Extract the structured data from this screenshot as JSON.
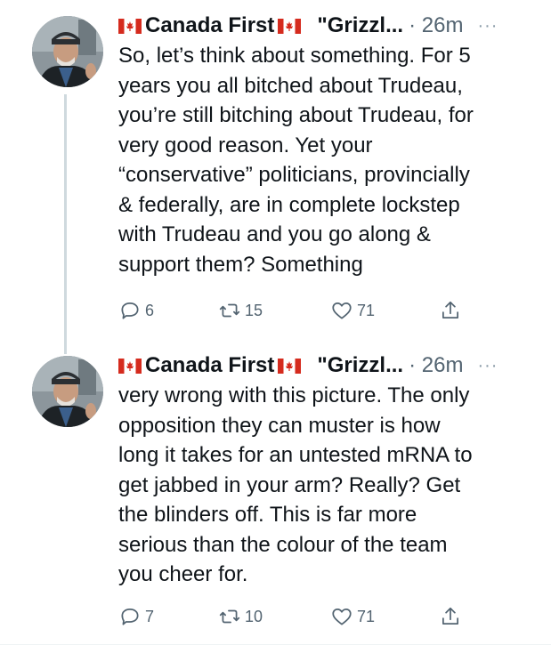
{
  "colors": {
    "text": "#0f1419",
    "muted": "#536471",
    "thread_line": "#cfd9de",
    "flag_red": "#d52b1e"
  },
  "tweets": [
    {
      "name": "Canada First",
      "handle": "\"Grizzl...",
      "time": "· 26m",
      "more": "···",
      "text": "So, let’s think about something. For 5\nyears you all bitched about Trudeau,\nyou’re still bitching about Trudeau, for\nvery good reason. Yet your\n“conservative” politicians, provincially\n& federally, are in complete lockstep\nwith Trudeau and you go along &\nsupport them? Something",
      "replies": "6",
      "retweets": "15",
      "likes": "71"
    },
    {
      "name": "Canada First",
      "handle": "\"Grizzl...",
      "time": "· 26m",
      "more": "···",
      "text": "very wrong with this picture. The only\nopposition they can muster is how\nlong it takes for an untested mRNA to\nget jabbed in your arm? Really? Get\nthe blinders off. This is far more\nserious than the colour of the team\nyou cheer for.",
      "replies": "7",
      "retweets": "10",
      "likes": "71"
    }
  ],
  "icons": [
    "canada-flag-icon",
    "reply-icon",
    "retweet-icon",
    "like-icon",
    "share-icon",
    "more-icon"
  ]
}
